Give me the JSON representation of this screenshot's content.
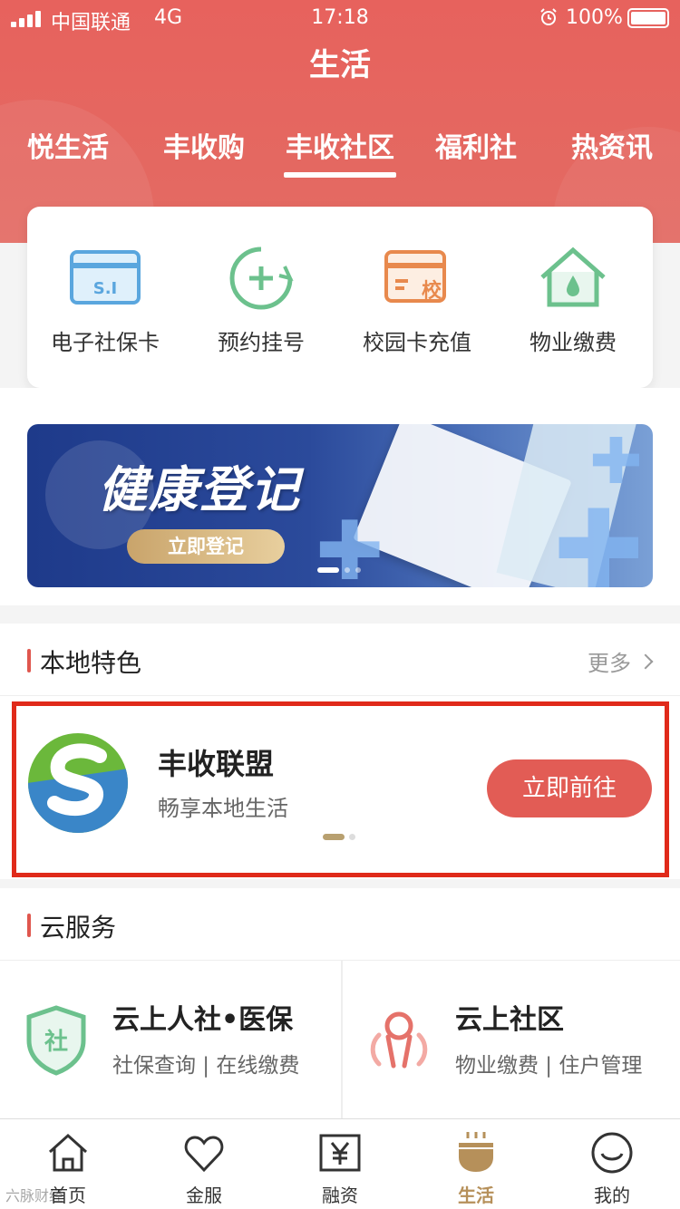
{
  "status_bar": {
    "carrier": "中国联通",
    "network": "4G",
    "time": "17:18",
    "battery": "100%"
  },
  "header": {
    "title": "生活"
  },
  "tabs": [
    {
      "label": "悦生活"
    },
    {
      "label": "丰收购"
    },
    {
      "label": "丰收社区",
      "active": true
    },
    {
      "label": "福利社"
    },
    {
      "label": "热资讯"
    }
  ],
  "quick_actions": [
    {
      "label": "电子社保卡",
      "icon": "social-security-card-icon"
    },
    {
      "label": "预约挂号",
      "icon": "appointment-plus-icon"
    },
    {
      "label": "校园卡充值",
      "icon": "campus-card-icon"
    },
    {
      "label": "物业缴费",
      "icon": "house-water-drop-icon"
    }
  ],
  "banner": {
    "headline": "健康登记",
    "button": "立即登记"
  },
  "local": {
    "section_title": "本地特色",
    "more": "更多",
    "name": "丰收联盟",
    "desc": "畅享本地生活",
    "button": "立即前往"
  },
  "cloud": {
    "section_title": "云服务",
    "items": [
      {
        "title": "云上人社•医保",
        "sub": "社保查询 | 在线缴费",
        "icon": "shield-she-icon"
      },
      {
        "title": "云上社区",
        "sub": "物业缴费 | 住户管理",
        "icon": "community-people-icon"
      }
    ]
  },
  "tabbar": [
    {
      "label": "首页",
      "icon": "home-icon"
    },
    {
      "label": "金服",
      "icon": "heart-icon"
    },
    {
      "label": "融资",
      "icon": "yuan-icon"
    },
    {
      "label": "生活",
      "icon": "cup-icon",
      "active": true
    },
    {
      "label": "我的",
      "icon": "smile-icon"
    }
  ],
  "watermark": "六脉财经",
  "colors": {
    "brand_red": "#e7625d",
    "accent_gold": "#b6905a",
    "highlight_red": "#e02a1a"
  }
}
